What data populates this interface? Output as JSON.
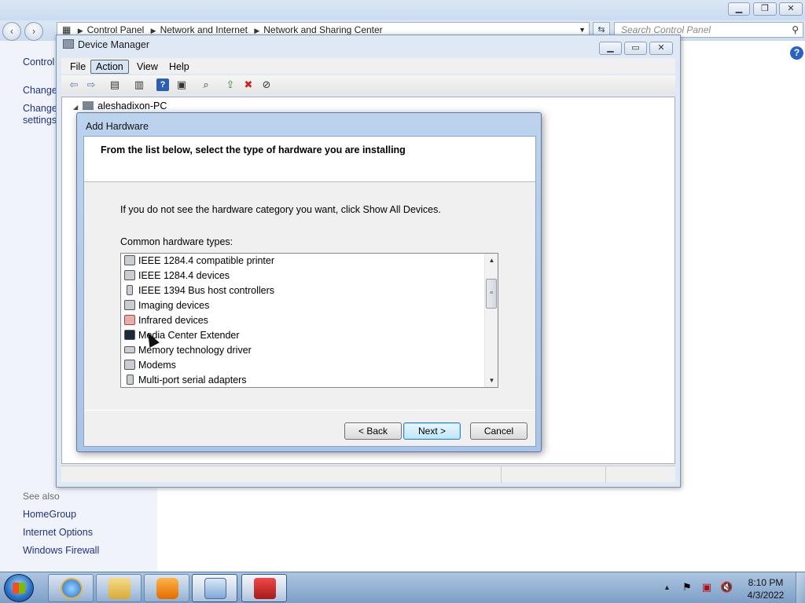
{
  "control_panel": {
    "breadcrumb": [
      "Control Panel",
      "Network and Internet",
      "Network and Sharing Center"
    ],
    "search_placeholder": "Search Control Panel",
    "left_links": [
      "Control",
      "Change",
      "Change",
      "settings"
    ],
    "see_also_label": "See also",
    "see_also": [
      "HomeGroup",
      "Internet Options",
      "Windows Firewall"
    ],
    "caption_buttons": [
      "minimize",
      "restore",
      "close"
    ]
  },
  "device_manager": {
    "title": "Device Manager",
    "menu": [
      "File",
      "Action",
      "View",
      "Help"
    ],
    "active_menu": "Action",
    "tree_root": "aleshadixon-PC",
    "toolbar_icons": [
      "back-icon",
      "forward-icon",
      "show-hide-console-tree-icon",
      "properties-icon",
      "help-icon",
      "show-action-pane-icon",
      "scan-hardware-icon",
      "update-driver-icon",
      "uninstall-icon",
      "disable-icon"
    ]
  },
  "add_hardware": {
    "title": "Add Hardware",
    "heading": "From the list below, select the type of hardware you are installing",
    "info": "If you do not see the hardware category you want, click Show All Devices.",
    "list_label": "Common hardware types:",
    "items": [
      "IEEE 1284.4 compatible printer",
      "IEEE 1284.4 devices",
      "IEEE 1394 Bus host controllers",
      "Imaging devices",
      "Infrared devices",
      "Media Center Extender",
      "Memory technology driver",
      "Modems",
      "Multi-port serial adapters"
    ],
    "buttons": {
      "back": "< Back",
      "next": "Next >",
      "cancel": "Cancel"
    }
  },
  "taskbar": {
    "apps": [
      "internet-explorer",
      "file-explorer",
      "media-player",
      "control-panel",
      "add-hardware-wizard"
    ],
    "clock_time": "8:10 PM",
    "clock_date": "4/3/2022"
  }
}
